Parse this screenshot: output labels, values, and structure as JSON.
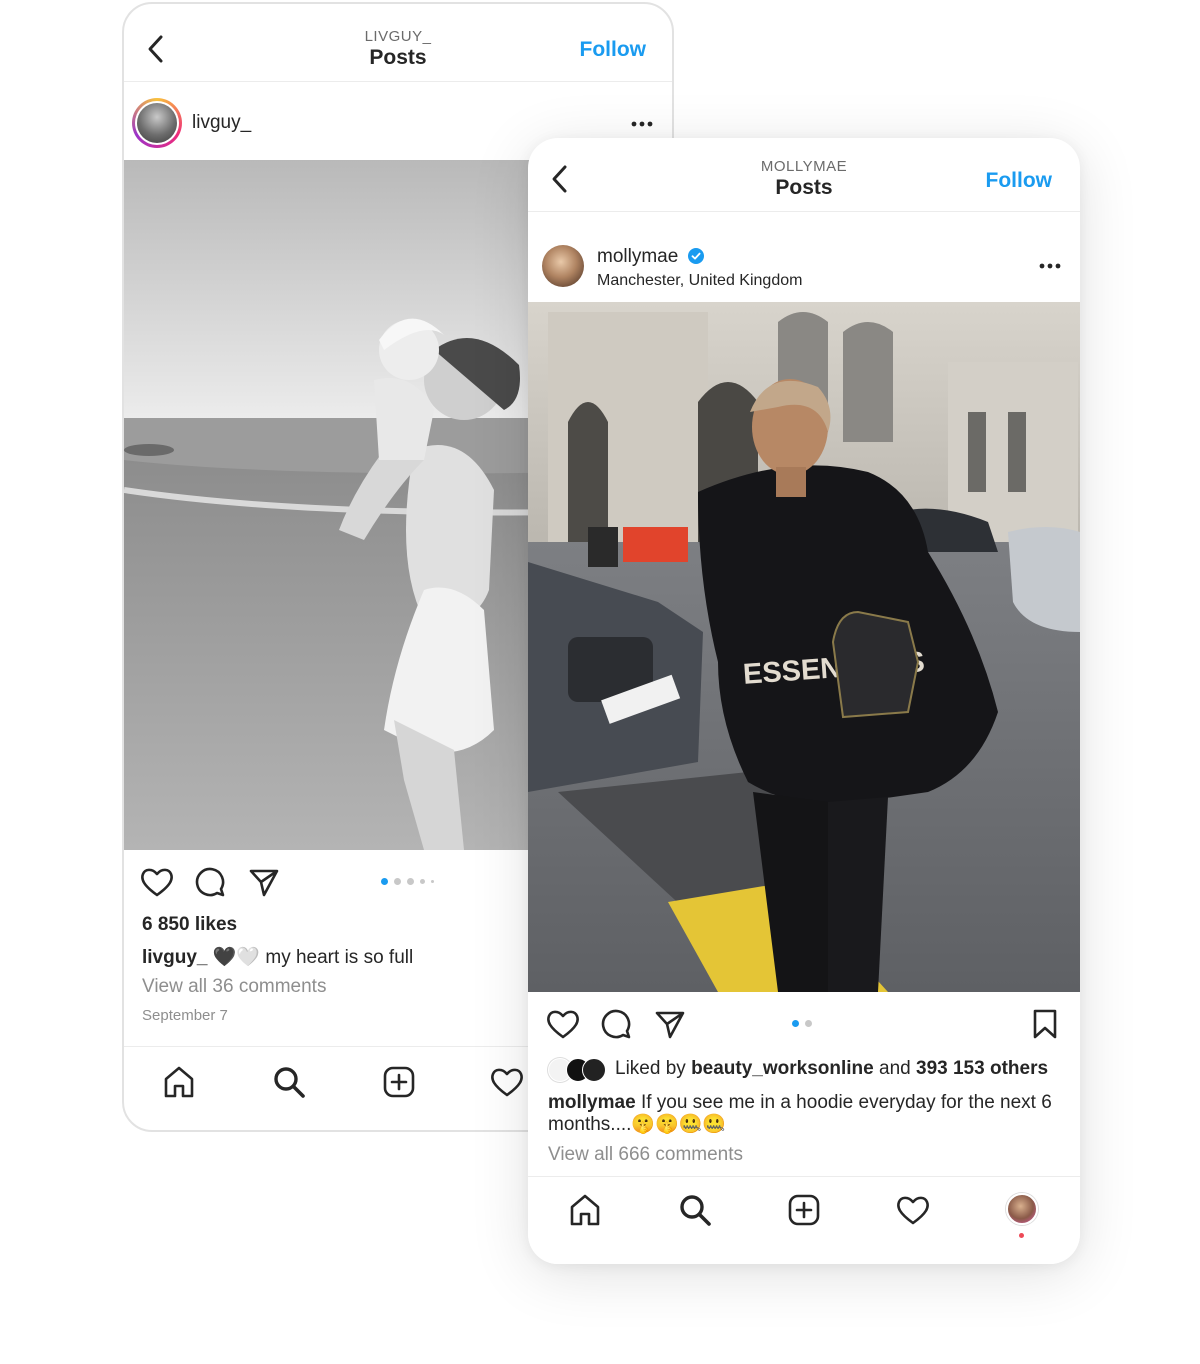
{
  "colors": {
    "accent": "#1a9bf0",
    "text": "#262626",
    "muted": "#8e8e8e",
    "notification": "#ed4956"
  },
  "back_post": {
    "header": {
      "username_caps": "LIVGUY_",
      "title": "Posts",
      "follow_label": "Follow"
    },
    "post": {
      "username": "livguy_",
      "likes": "6 850 likes",
      "caption_user": "livguy_",
      "caption_emoji": "🖤🤍",
      "caption_text": "my heart is so full",
      "comments_link": "View all 36 comments",
      "date": "September 7",
      "carousel": {
        "count": 5,
        "active": 1
      }
    },
    "nav": [
      "home-icon",
      "search-icon",
      "add-post-icon",
      "heart-icon"
    ]
  },
  "front_post": {
    "header": {
      "username_caps": "MOLLYMAE",
      "title": "Posts",
      "follow_label": "Follow"
    },
    "post": {
      "username": "mollymae",
      "verified": true,
      "location": "Manchester, United Kingdom",
      "liked_by_prefix": "Liked by",
      "liked_by_user": "beauty_worksonline",
      "liked_by_and": "and",
      "liked_by_others": "393 153 others",
      "caption_user": "mollymae",
      "caption_text": "If you see me in a hoodie everyday for the next 6 months....🤫🤫🤐🤐",
      "comments_link": "View all 666 comments",
      "carousel": {
        "count": 2,
        "active": 1
      }
    },
    "nav": [
      "home-icon",
      "search-icon",
      "add-post-icon",
      "heart-icon",
      "profile-avatar"
    ]
  }
}
